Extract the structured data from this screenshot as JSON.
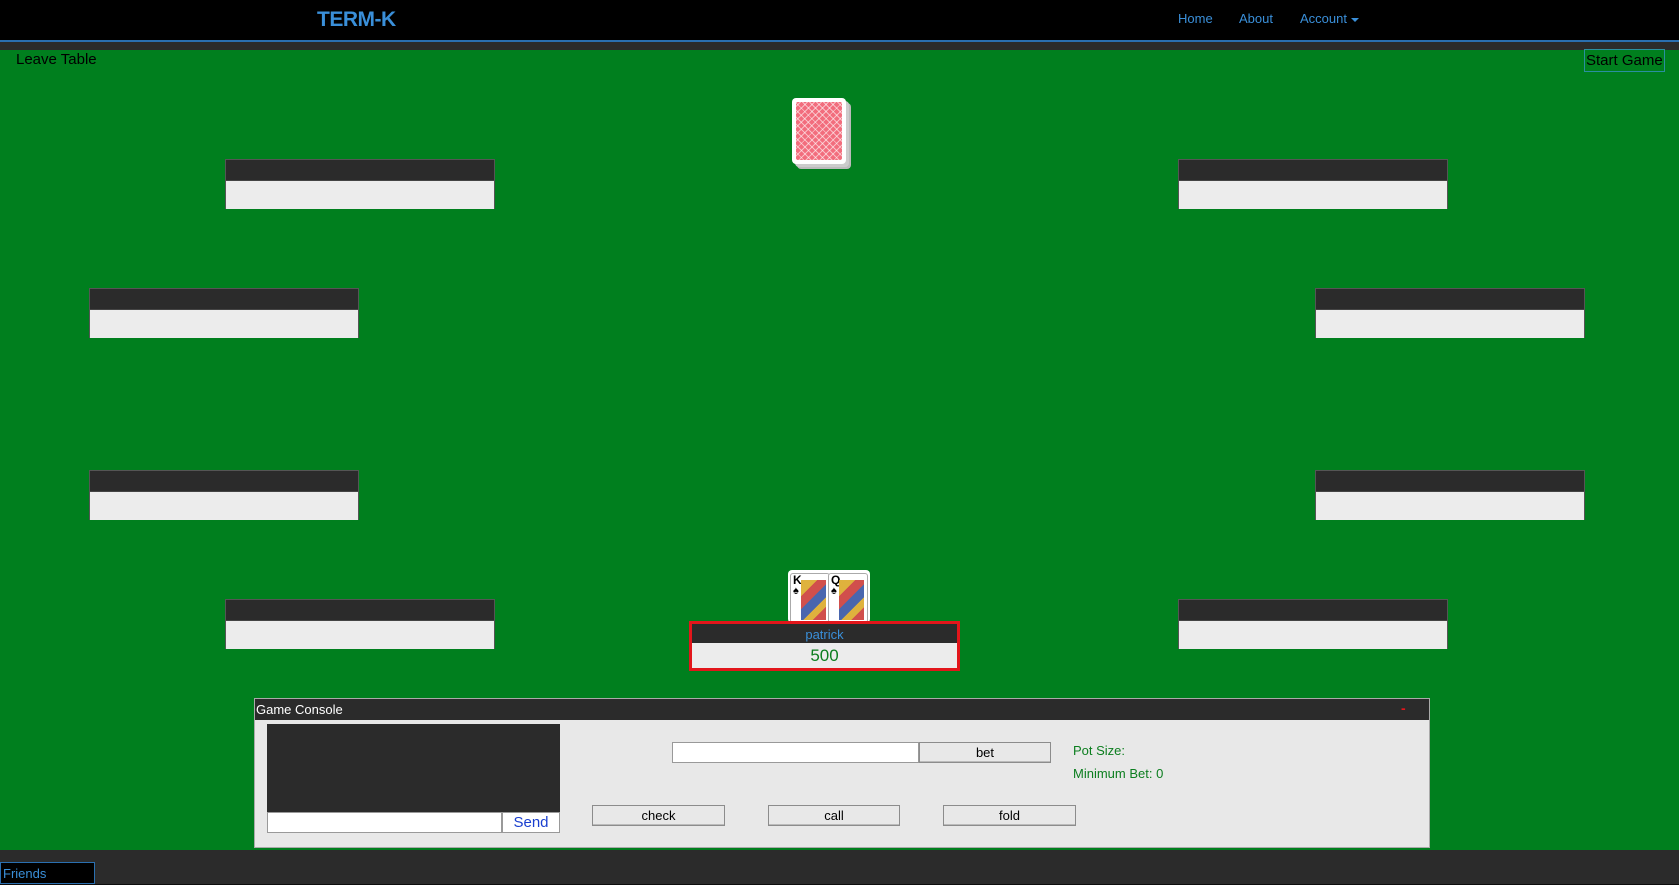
{
  "navbar": {
    "brand": "TERM-K",
    "links": {
      "home": "Home",
      "about": "About",
      "account": "Account"
    }
  },
  "table": {
    "leave_label": "Leave Table",
    "start_label": "Start Game",
    "empty_seats": 8
  },
  "player": {
    "name": "patrick",
    "chips": "500",
    "hand": [
      {
        "rank": "K",
        "suit": "♠"
      },
      {
        "rank": "Q",
        "suit": "♠"
      }
    ]
  },
  "console": {
    "title": "Game Console",
    "minimize_symbol": "-",
    "send_label": "Send",
    "bet_label": "bet",
    "check_label": "check",
    "call_label": "call",
    "fold_label": "fold",
    "pot_label": "Pot Size:",
    "min_bet_label": "Minimum Bet: 0"
  },
  "footer": {
    "friends_label": "Friends"
  },
  "colors": {
    "felt": "#007f1e",
    "accent": "#3a8fd9",
    "highlight": "#e2161b",
    "chips": "#0c7e1f"
  }
}
